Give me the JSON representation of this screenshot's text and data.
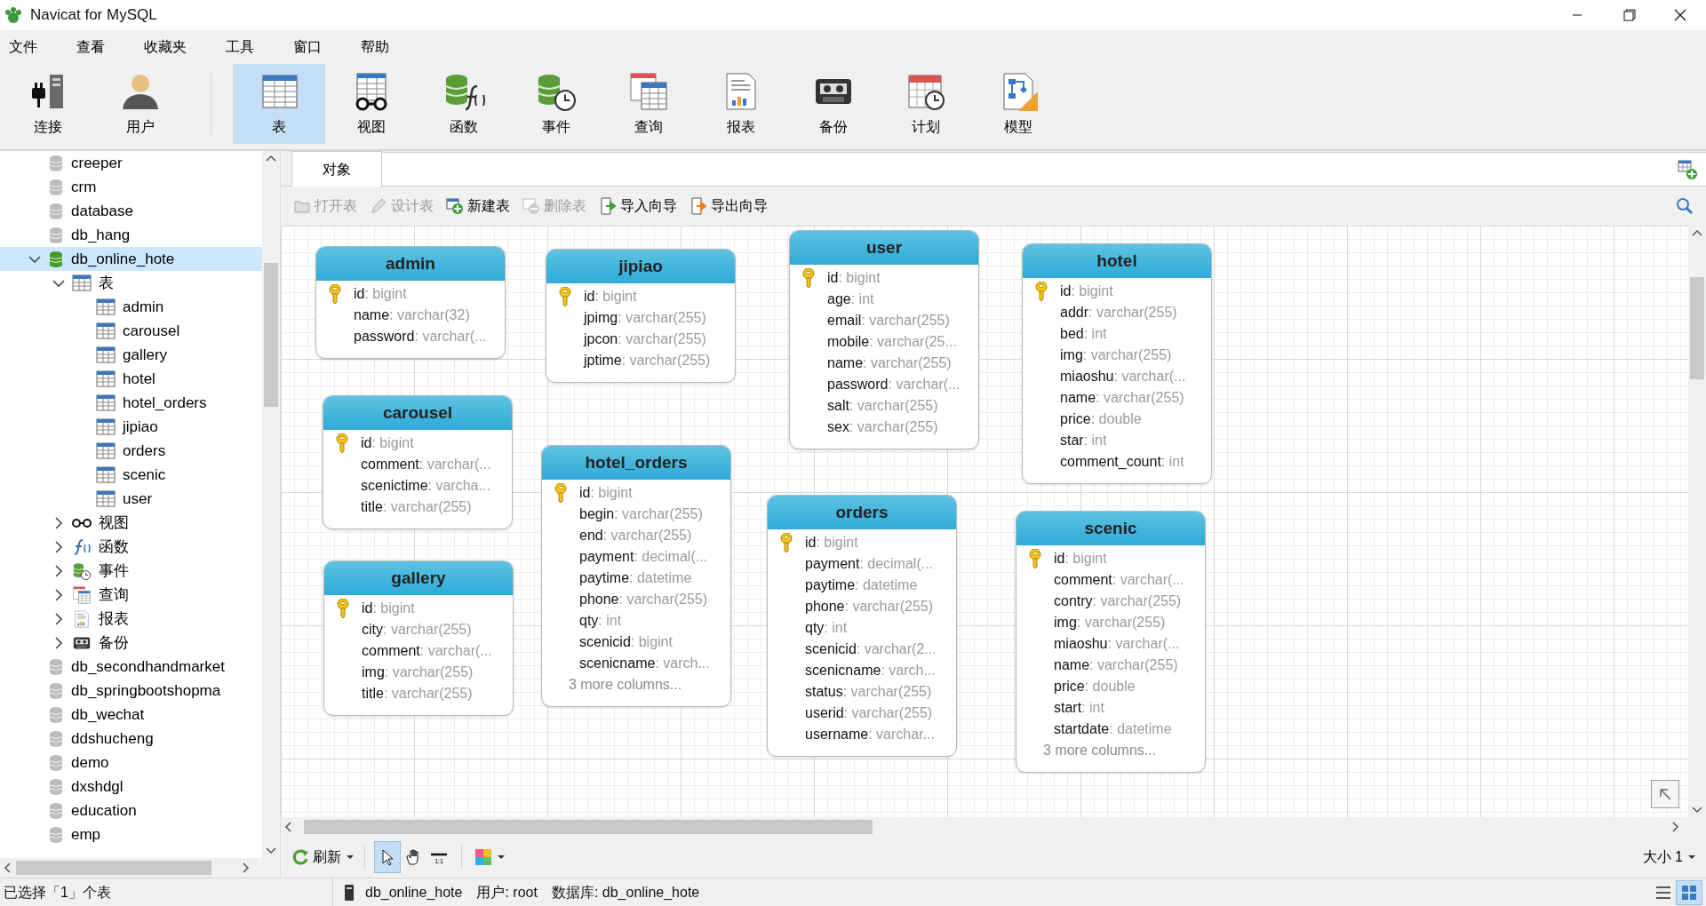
{
  "window": {
    "title": "Navicat for MySQL"
  },
  "menu": [
    "文件",
    "查看",
    "收藏夹",
    "工具",
    "窗口",
    "帮助"
  ],
  "toolbar": [
    [
      {
        "label": "连接",
        "kind": "connection",
        "selected": false
      },
      {
        "label": "用户",
        "kind": "user",
        "selected": false
      }
    ],
    [
      {
        "label": "表",
        "kind": "table",
        "selected": true
      },
      {
        "label": "视图",
        "kind": "view",
        "selected": false
      },
      {
        "label": "函数",
        "kind": "function",
        "selected": false
      },
      {
        "label": "事件",
        "kind": "event",
        "selected": false
      },
      {
        "label": "查询",
        "kind": "query",
        "selected": false
      },
      {
        "label": "报表",
        "kind": "report",
        "selected": false
      },
      {
        "label": "备份",
        "kind": "backup",
        "selected": false
      },
      {
        "label": "计划",
        "kind": "schedule",
        "selected": false
      },
      {
        "label": "模型",
        "kind": "model",
        "selected": false
      }
    ]
  ],
  "sidebar": {
    "items": [
      {
        "label": "creeper",
        "kind": "database",
        "open": false,
        "selected": false
      },
      {
        "label": "crm",
        "kind": "database",
        "open": false,
        "selected": false
      },
      {
        "label": "database",
        "kind": "database",
        "open": false,
        "selected": false
      },
      {
        "label": "db_hang",
        "kind": "database",
        "open": false,
        "selected": false
      },
      {
        "label": "db_online_hote",
        "kind": "database",
        "open": true,
        "selected": true,
        "expanded": true,
        "children": [
          {
            "label": "表",
            "kind": "tables",
            "selected": false,
            "expanded": true,
            "children": [
              {
                "label": "admin",
                "kind": "table",
                "selected": false
              },
              {
                "label": "carousel",
                "kind": "table",
                "selected": false
              },
              {
                "label": "gallery",
                "kind": "table",
                "selected": false
              },
              {
                "label": "hotel",
                "kind": "table",
                "selected": false
              },
              {
                "label": "hotel_orders",
                "kind": "table",
                "selected": false
              },
              {
                "label": "jipiao",
                "kind": "table",
                "selected": false
              },
              {
                "label": "orders",
                "kind": "table",
                "selected": false
              },
              {
                "label": "scenic",
                "kind": "table",
                "selected": false
              },
              {
                "label": "user",
                "kind": "table",
                "selected": false
              }
            ]
          },
          {
            "label": "视图",
            "kind": "view",
            "selected": false,
            "expanded": false
          },
          {
            "label": "函数",
            "kind": "function",
            "selected": false,
            "expanded": false
          },
          {
            "label": "事件",
            "kind": "event",
            "selected": false,
            "expanded": false
          },
          {
            "label": "查询",
            "kind": "query",
            "selected": false,
            "expanded": false
          },
          {
            "label": "报表",
            "kind": "report",
            "selected": false,
            "expanded": false
          },
          {
            "label": "备份",
            "kind": "backup",
            "selected": false,
            "expanded": false
          }
        ]
      },
      {
        "label": "db_secondhandmarket",
        "kind": "database",
        "open": false,
        "selected": false
      },
      {
        "label": "db_springbootshopma",
        "kind": "database",
        "open": false,
        "selected": false
      },
      {
        "label": "db_wechat",
        "kind": "database",
        "open": false,
        "selected": false
      },
      {
        "label": "ddshucheng",
        "kind": "database",
        "open": false,
        "selected": false
      },
      {
        "label": "demo",
        "kind": "database",
        "open": false,
        "selected": false
      },
      {
        "label": "dxshdgl",
        "kind": "database",
        "open": false,
        "selected": false
      },
      {
        "label": "education",
        "kind": "database",
        "open": false,
        "selected": false
      },
      {
        "label": "emp",
        "kind": "database",
        "open": false,
        "selected": false
      }
    ]
  },
  "tabs": [
    {
      "label": "对象",
      "selected": true
    }
  ],
  "object_toolbar": [
    {
      "label": "打开表",
      "kind": "open",
      "disabled": true
    },
    {
      "label": "设计表",
      "kind": "design",
      "disabled": true
    },
    {
      "label": "新建表",
      "kind": "new",
      "disabled": false
    },
    {
      "label": "删除表",
      "kind": "delete",
      "disabled": true
    },
    {
      "label": "导入向导",
      "kind": "import",
      "disabled": false
    },
    {
      "label": "导出向导",
      "kind": "export",
      "disabled": false
    }
  ],
  "diagram": {
    "tables": [
      {
        "name": "admin",
        "columns": [
          {
            "name": "id",
            "type": ": bigint",
            "primary_key": true
          },
          {
            "name": "name",
            "type": ": varchar(32)",
            "primary_key": false
          },
          {
            "name": "password",
            "type": ": varchar(...",
            "primary_key": false
          }
        ]
      },
      {
        "name": "jipiao",
        "columns": [
          {
            "name": "id",
            "type": ": bigint",
            "primary_key": true
          },
          {
            "name": "jpimg",
            "type": ": varchar(255)",
            "primary_key": false
          },
          {
            "name": "jpcon",
            "type": ": varchar(255)",
            "primary_key": false
          },
          {
            "name": "jptime",
            "type": ": varchar(255)",
            "primary_key": false
          }
        ]
      },
      {
        "name": "user",
        "columns": [
          {
            "name": "id",
            "type": ": bigint",
            "primary_key": true
          },
          {
            "name": "age",
            "type": ": int",
            "primary_key": false
          },
          {
            "name": "email",
            "type": ": varchar(255)",
            "primary_key": false
          },
          {
            "name": "mobile",
            "type": ": varchar(25...",
            "primary_key": false
          },
          {
            "name": "name",
            "type": ": varchar(255)",
            "primary_key": false
          },
          {
            "name": "password",
            "type": ": varchar(...",
            "primary_key": false
          },
          {
            "name": "salt",
            "type": ": varchar(255)",
            "primary_key": false
          },
          {
            "name": "sex",
            "type": ": varchar(255)",
            "primary_key": false
          }
        ]
      },
      {
        "name": "hotel",
        "columns": [
          {
            "name": "id",
            "type": ": bigint",
            "primary_key": true
          },
          {
            "name": "addr",
            "type": ": varchar(255)",
            "primary_key": false
          },
          {
            "name": "bed",
            "type": ": int",
            "primary_key": false
          },
          {
            "name": "img",
            "type": ": varchar(255)",
            "primary_key": false
          },
          {
            "name": "miaoshu",
            "type": ": varchar(...",
            "primary_key": false
          },
          {
            "name": "name",
            "type": ": varchar(255)",
            "primary_key": false
          },
          {
            "name": "price",
            "type": ": double",
            "primary_key": false
          },
          {
            "name": "star",
            "type": ": int",
            "primary_key": false
          },
          {
            "name": "comment_count",
            "type": ": int",
            "primary_key": false
          }
        ]
      },
      {
        "name": "carousel",
        "columns": [
          {
            "name": "id",
            "type": ": bigint",
            "primary_key": true
          },
          {
            "name": "comment",
            "type": ": varchar(...",
            "primary_key": false
          },
          {
            "name": "scenictime",
            "type": ": varcha...",
            "primary_key": false
          },
          {
            "name": "title",
            "type": ": varchar(255)",
            "primary_key": false
          }
        ]
      },
      {
        "name": "hotel_orders",
        "columns": [
          {
            "name": "id",
            "type": ": bigint",
            "primary_key": true
          },
          {
            "name": "begin",
            "type": ": varchar(255)",
            "primary_key": false
          },
          {
            "name": "end",
            "type": ": varchar(255)",
            "primary_key": false
          },
          {
            "name": "payment",
            "type": ": decimal(...",
            "primary_key": false
          },
          {
            "name": "paytime",
            "type": ": datetime",
            "primary_key": false
          },
          {
            "name": "phone",
            "type": ": varchar(255)",
            "primary_key": false
          },
          {
            "name": "qty",
            "type": ": int",
            "primary_key": false
          },
          {
            "name": "scenicid",
            "type": ": bigint",
            "primary_key": false
          },
          {
            "name": "scenicname",
            "type": ": varch...",
            "primary_key": false
          }
        ],
        "more": "3 more columns..."
      },
      {
        "name": "orders",
        "columns": [
          {
            "name": "id",
            "type": ": bigint",
            "primary_key": true
          },
          {
            "name": "payment",
            "type": ": decimal(...",
            "primary_key": false
          },
          {
            "name": "paytime",
            "type": ": datetime",
            "primary_key": false
          },
          {
            "name": "phone",
            "type": ": varchar(255)",
            "primary_key": false
          },
          {
            "name": "qty",
            "type": ": int",
            "primary_key": false
          },
          {
            "name": "scenicid",
            "type": ": varchar(2...",
            "primary_key": false
          },
          {
            "name": "scenicname",
            "type": ": varch...",
            "primary_key": false
          },
          {
            "name": "status",
            "type": ": varchar(255)",
            "primary_key": false
          },
          {
            "name": "userid",
            "type": ": varchar(255)",
            "primary_key": false
          },
          {
            "name": "username",
            "type": ": varchar...",
            "primary_key": false
          }
        ]
      },
      {
        "name": "gallery",
        "columns": [
          {
            "name": "id",
            "type": ": bigint",
            "primary_key": true
          },
          {
            "name": "city",
            "type": ": varchar(255)",
            "primary_key": false
          },
          {
            "name": "comment",
            "type": ": varchar(...",
            "primary_key": false
          },
          {
            "name": "img",
            "type": ": varchar(255)",
            "primary_key": false
          },
          {
            "name": "title",
            "type": ": varchar(255)",
            "primary_key": false
          }
        ]
      },
      {
        "name": "scenic",
        "columns": [
          {
            "name": "id",
            "type": ": bigint",
            "primary_key": true
          },
          {
            "name": "comment",
            "type": ": varchar(...",
            "primary_key": false
          },
          {
            "name": "contry",
            "type": ": varchar(255)",
            "primary_key": false
          },
          {
            "name": "img",
            "type": ": varchar(255)",
            "primary_key": false
          },
          {
            "name": "miaoshu",
            "type": ": varchar(...",
            "primary_key": false
          },
          {
            "name": "name",
            "type": ": varchar(255)",
            "primary_key": false
          },
          {
            "name": "price",
            "type": ": double",
            "primary_key": false
          },
          {
            "name": "start",
            "type": ": int",
            "primary_key": false
          },
          {
            "name": "startdate",
            "type": ": datetime",
            "primary_key": false
          }
        ],
        "more": "3 more columns..."
      }
    ]
  },
  "bottom_toolbar": {
    "refresh": "刷新",
    "tools": [
      {
        "kind": "pointer",
        "selected": true
      },
      {
        "kind": "hand",
        "selected": false
      },
      {
        "kind": "actual-size",
        "label": "1:1",
        "selected": false
      }
    ],
    "size": "大小 1"
  },
  "status_bar": {
    "selection": "已选择「1」个表",
    "connection": "db_online_hote",
    "user": "用户: root",
    "database": "数据库: db_online_hote"
  }
}
